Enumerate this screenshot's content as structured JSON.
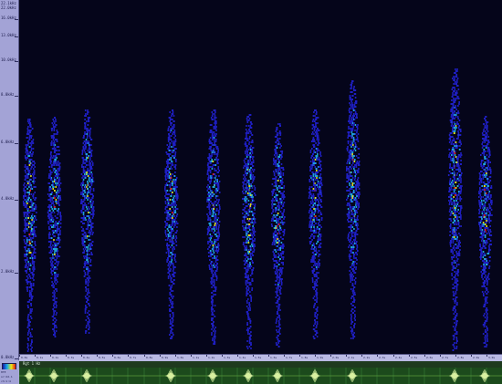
{
  "window": {
    "corner_top": "22.1kHz",
    "corner_sub": "22.0kHz"
  },
  "frequency_axis": {
    "labels": [
      "16.0kHz",
      "13.0kHz",
      "10.0kHz",
      "8.0kHz",
      "6.0kHz",
      "4.0kHz",
      "2.0kHz",
      "0.0kHz"
    ]
  },
  "time_axis": {
    "labels": [
      "0.0s",
      "0.1s",
      "0.2s",
      "0.3s",
      "0.4s",
      "0.5s",
      "0.6s",
      "0.7s",
      "0.8s",
      "0.9s",
      "1.0s",
      "1.1s",
      "1.2s",
      "1.3s",
      "1.4s",
      "1.5s",
      "1.6s",
      "1.7s",
      "1.8s",
      "1.9s",
      "2.0s",
      "2.1s",
      "2.2s",
      "2.3s",
      "2.4s",
      "2.5s",
      "2.6s",
      "2.7s",
      "2.8s",
      "2.9s",
      "3.0s"
    ]
  },
  "waveform": {
    "channel_name": "Rgt 1 Hz"
  },
  "left_readout": {
    "lines": [
      "8TE",
      "sr:22.1",
      "ch:1:4"
    ]
  },
  "colors": {
    "spectrogram_background": "#05051a",
    "low_energy": "#2020c8",
    "mid_energy": "#20a8e0",
    "high_energy": "#e0e020",
    "peak_energy": "#e82020",
    "waveform_background": "#1c4a1c",
    "waveform_trace": "#d8f0a0"
  }
}
